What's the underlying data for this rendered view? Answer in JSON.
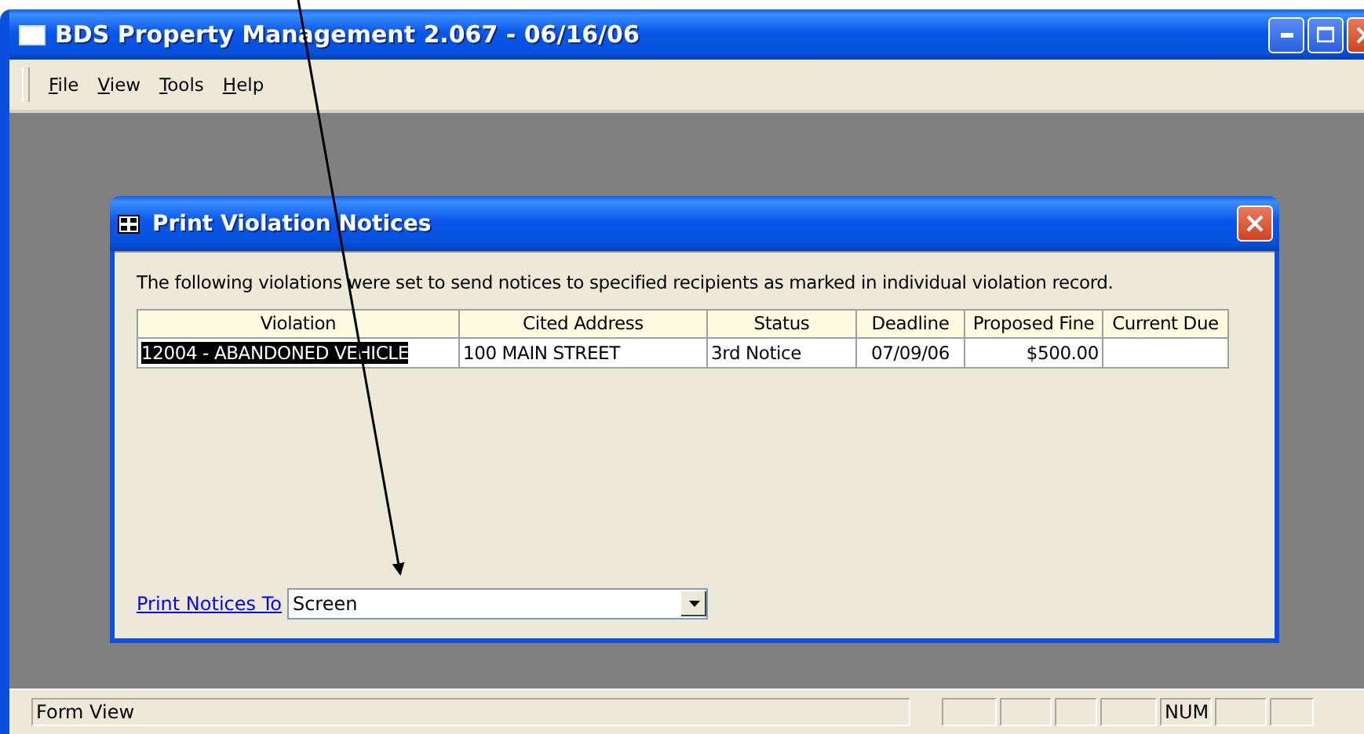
{
  "window": {
    "title": "BDS Property Management 2.067 - 06/16/06"
  },
  "menu": [
    {
      "label": "File"
    },
    {
      "label": "View"
    },
    {
      "label": "Tools"
    },
    {
      "label": "Help"
    }
  ],
  "dialog": {
    "title": "Print Violation Notices",
    "message": "The following violations were set to send notices to specified recipients as marked in individual violation record.",
    "table": {
      "columns": [
        "Violation",
        "Cited Address",
        "Status",
        "Deadline",
        "Proposed Fine",
        "Current Due"
      ],
      "rows": [
        {
          "selected": true,
          "cells": [
            "12004 - ABANDONED VEHICLE",
            "100 MAIN STREET",
            "3rd Notice",
            "07/09/06",
            "$500.00",
            ""
          ]
        }
      ]
    },
    "print_to": {
      "label": "Print Notices To",
      "value": "Screen"
    }
  },
  "status_bar": {
    "message": "Form View",
    "indicators": [
      {
        "kind": "blank"
      },
      {
        "kind": "blank"
      },
      {
        "kind": "blank"
      },
      {
        "kind": "blank"
      },
      {
        "kind": "text",
        "label": "NUM"
      },
      {
        "kind": "blank"
      },
      {
        "kind": "blank"
      }
    ]
  }
}
